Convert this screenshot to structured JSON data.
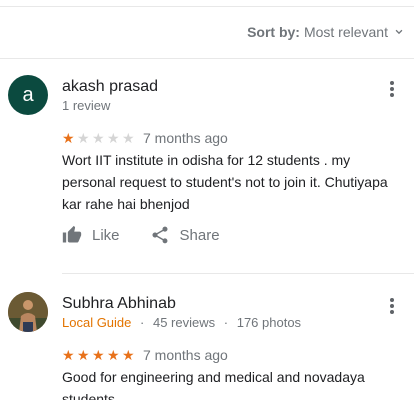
{
  "sort": {
    "label": "Sort by:",
    "value": "Most relevant"
  },
  "reviews": [
    {
      "avatar_letter": "a",
      "author": "akash prasad",
      "meta": "1 review",
      "rating": 1,
      "time": "7 months ago",
      "text": "Wort IIT institute in odisha for 12 students . my personal request to student's not to join it. Chutiyapa kar rahe hai bhenjod",
      "like_label": "Like",
      "share_label": "Share"
    },
    {
      "author": "Subhra Abhinab",
      "badge": "Local Guide",
      "reviews_count": "45 reviews",
      "photos_count": "176 photos",
      "separator": "·",
      "rating": 5,
      "time": "7 months ago",
      "text": "Good for engineering and medical and novadaya students"
    }
  ],
  "colors": {
    "avatar_bg": "#0b4a3f",
    "star": "#f4a81d",
    "local_guide": "#e37400"
  },
  "icons": [
    "chevron-down-icon",
    "more-vert-icon",
    "thumb-up-icon",
    "share-icon",
    "star-icon"
  ]
}
